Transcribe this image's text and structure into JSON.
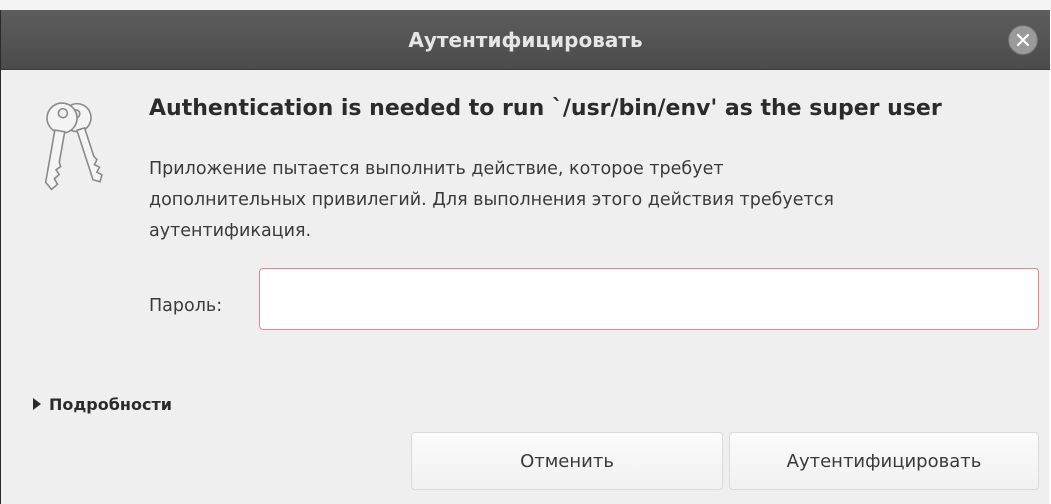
{
  "window": {
    "title": "Аутентифицировать",
    "close_icon": "close-icon"
  },
  "dialog": {
    "icon": "keys-icon",
    "heading": "Authentication is needed to run `/usr/bin/env' as the super user",
    "message_lines": [
      "Приложение пытается выполнить действие, которое требует",
      "дополнительных привилегий. Для выполнения этого действия требуется",
      "аутентификация."
    ],
    "password_label": "Пароль:",
    "password_value": "",
    "details_label": "Подробности",
    "cancel_label": "Отменить",
    "authenticate_label": "Аутентифицировать"
  },
  "colors": {
    "titlebar": "#555555",
    "dialog_bg": "#efefef",
    "input_error_border": "#e8838c"
  }
}
